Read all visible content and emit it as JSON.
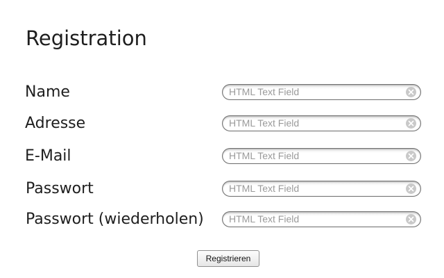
{
  "form": {
    "title": "Registration",
    "fields": [
      {
        "label": "Name",
        "value": "",
        "placeholder": "HTML Text Field"
      },
      {
        "label": "Adresse",
        "value": "",
        "placeholder": "HTML Text Field"
      },
      {
        "label": "E-Mail",
        "value": "",
        "placeholder": "HTML Text Field"
      },
      {
        "label": "Passwort",
        "value": "",
        "placeholder": "HTML Text Field"
      },
      {
        "label": "Passwort (wiederholen)",
        "value": "",
        "placeholder": "HTML Text Field"
      }
    ],
    "submit_label": "Registrieren"
  },
  "icons": {
    "clear": "clear-circle-x-icon"
  },
  "colors": {
    "background": "#ffffff",
    "field_border": "#6e6e6e",
    "placeholder": "#9a9a9a",
    "clear_icon": "#c9c9c9"
  }
}
